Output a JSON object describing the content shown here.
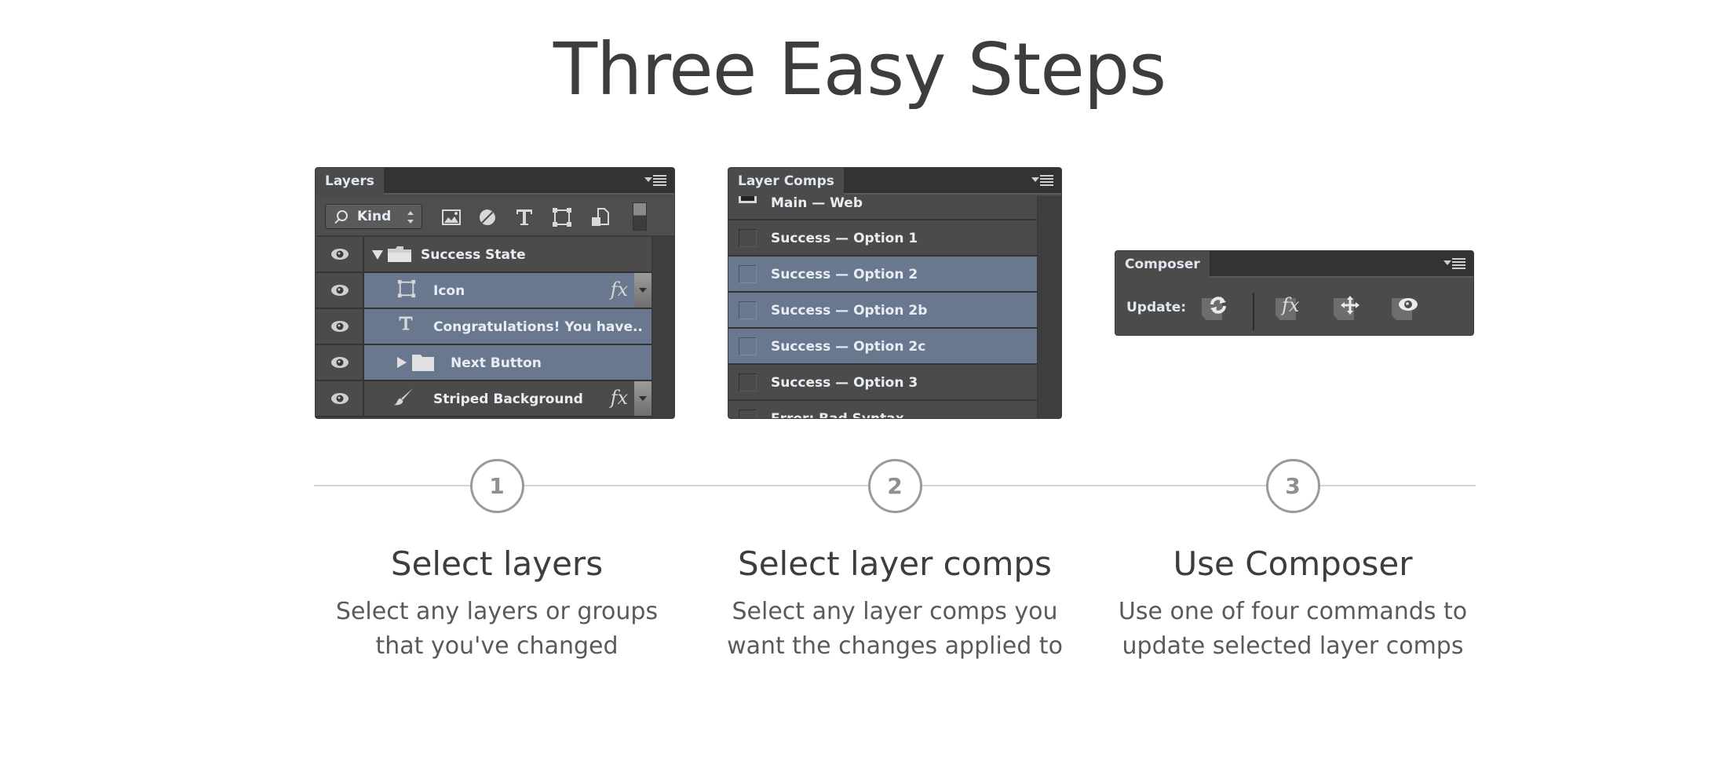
{
  "page": {
    "title": "Three Easy Steps"
  },
  "layers_panel": {
    "tab_label": "Layers",
    "filter": {
      "selected": "Kind"
    },
    "filter_icons": [
      "pixel-layer-filter-icon",
      "adjustment-layer-filter-icon",
      "type-layer-filter-icon",
      "shape-layer-filter-icon",
      "smart-object-filter-icon"
    ],
    "rows": [
      {
        "name": "Success State",
        "type": "group-expanded",
        "visible": true,
        "selected": false,
        "fx": false
      },
      {
        "name": "Icon",
        "type": "shape",
        "visible": true,
        "selected": true,
        "fx": true
      },
      {
        "name": "Congratulations! You have..",
        "type": "text",
        "visible": true,
        "selected": true,
        "fx": false
      },
      {
        "name": "Next Button",
        "type": "group-collapsed",
        "visible": true,
        "selected": true,
        "fx": false
      },
      {
        "name": "Striped Background",
        "type": "brush",
        "visible": true,
        "selected": false,
        "fx": true
      }
    ],
    "fx_label": "fx"
  },
  "comps_panel": {
    "tab_label": "Layer Comps",
    "rows": [
      {
        "name": "Main — Web",
        "selected": false,
        "doc_icon": true
      },
      {
        "name": "Success — Option 1",
        "selected": false
      },
      {
        "name": "Success — Option 2",
        "selected": true
      },
      {
        "name": "Success — Option 2b",
        "selected": true
      },
      {
        "name": "Success — Option 2c",
        "selected": true
      },
      {
        "name": "Success — Option 3",
        "selected": false
      },
      {
        "name": "Error: Bad Syntax",
        "selected": false
      }
    ]
  },
  "composer_panel": {
    "tab_label": "Composer",
    "update_label": "Update:",
    "commands": [
      {
        "name": "update-all",
        "icon": "refresh-icon"
      },
      {
        "name": "update-style",
        "icon": "fx-icon",
        "glyph": "fx"
      },
      {
        "name": "update-position",
        "icon": "move-icon"
      },
      {
        "name": "update-visibility",
        "icon": "eye-icon"
      }
    ]
  },
  "steps": [
    {
      "number": "1",
      "heading": "Select layers",
      "description": "Select any layers or groups that you've changed"
    },
    {
      "number": "2",
      "heading": "Select layer comps",
      "description": "Select any layer comps you want the changes applied to"
    },
    {
      "number": "3",
      "heading": "Use Composer",
      "description": "Use one of four commands to update selected layer comps"
    }
  ],
  "colors": {
    "panel_bg": "#4b4b4b",
    "panel_header": "#333333",
    "selection": "#69788f",
    "title_text": "#3d3d3d",
    "step_circle": "#9a9a9a",
    "divider": "#d6d6d6"
  }
}
